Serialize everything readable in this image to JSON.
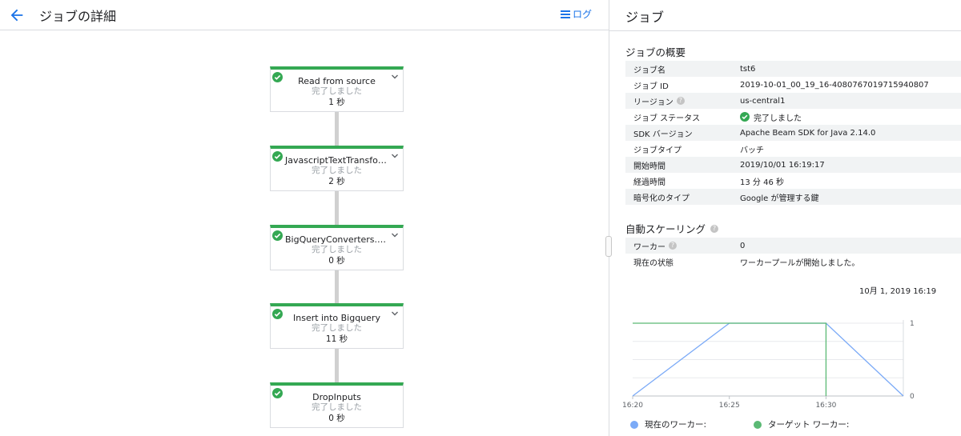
{
  "header": {
    "title": "ジョブの詳細",
    "log_label": "ログ"
  },
  "pipeline": {
    "nodes": [
      {
        "name": "Read from source",
        "status": "完了しました",
        "time": "1 秒"
      },
      {
        "name": "JavascriptTextTransfor…",
        "status": "完了しました",
        "time": "2 秒"
      },
      {
        "name": "BigQueryConverters.Jso…",
        "status": "完了しました",
        "time": "0 秒"
      },
      {
        "name": "Insert into Bigquery",
        "status": "完了しました",
        "time": "11 秒"
      },
      {
        "name": "DropInputs",
        "status": "完了しました",
        "time": "0 秒"
      }
    ]
  },
  "panel": {
    "title": "ジョブ",
    "summary_title": "ジョブの概要",
    "summary": [
      {
        "key": "ジョブ名",
        "value": "tst6"
      },
      {
        "key": "ジョブ ID",
        "value": "2019-10-01_00_19_16-4080767019715940807"
      },
      {
        "key": "リージョン",
        "value": "us-central1"
      },
      {
        "key": "ジョブ ステータス",
        "value": "完了しました"
      },
      {
        "key": "SDK バージョン",
        "value": "Apache Beam SDK for Java 2.14.0"
      },
      {
        "key": "ジョブタイプ",
        "value": "バッチ"
      },
      {
        "key": "開始時間",
        "value": "2019/10/01 16:19:17"
      },
      {
        "key": "経過時間",
        "value": "13 分 46 秒"
      },
      {
        "key": "暗号化のタイプ",
        "value": "Google が管理する鍵"
      }
    ],
    "autoscaling_title": "自動スケーリング",
    "autoscaling": [
      {
        "key": "ワーカー",
        "value": "0"
      },
      {
        "key": "現在の状態",
        "value": "ワーカープールが開始しました。"
      }
    ],
    "chart_date": "10月 1, 2019 16:19"
  },
  "colors": {
    "accent": "#1a73e8",
    "success": "#34a853",
    "current": "#7baaf7",
    "target": "#5bb974"
  },
  "chart_data": {
    "type": "line",
    "x_ticks": [
      "16:20",
      "16:25",
      "16:30"
    ],
    "y_ticks": [
      "0",
      "1"
    ],
    "ylim": [
      0,
      1
    ],
    "xlim": [
      "16:20",
      "16:34"
    ],
    "series": [
      {
        "name": "現在のワーカー:",
        "points": [
          [
            "16:20",
            0
          ],
          [
            "16:25",
            1
          ],
          [
            "16:30",
            1
          ],
          [
            "16:34",
            0
          ]
        ]
      },
      {
        "name": "ターゲット ワーカー:",
        "points": [
          [
            "16:20",
            1
          ],
          [
            "16:30",
            1
          ],
          [
            "16:30",
            0
          ]
        ]
      }
    ]
  }
}
